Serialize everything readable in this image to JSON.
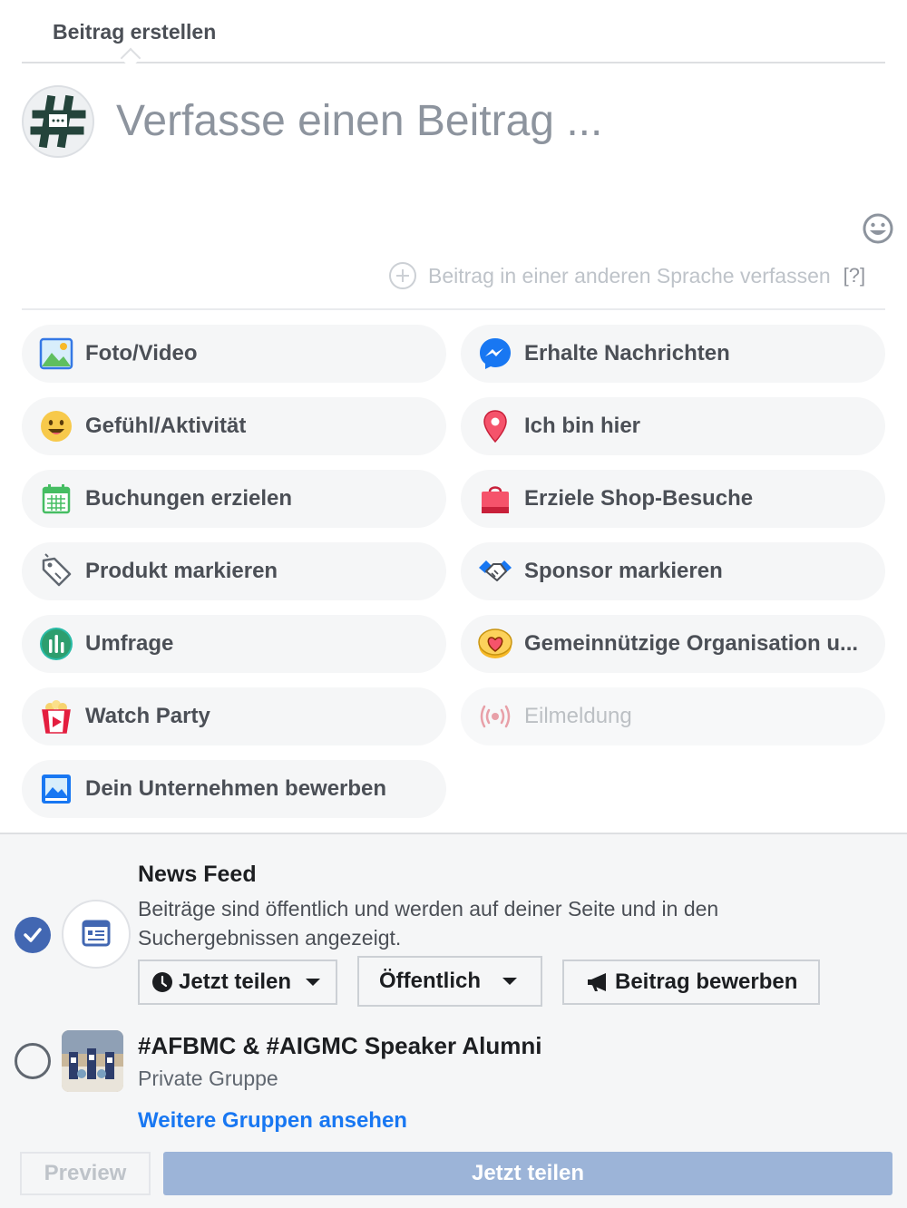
{
  "header": {
    "title": "Beitrag erstellen"
  },
  "composer": {
    "placeholder": "Verfasse einen Beitrag ..."
  },
  "language": {
    "text": "Beitrag in einer anderen Sprache verfassen",
    "help": "[?]"
  },
  "options": [
    {
      "label": "Foto/Video",
      "icon": "photo-icon"
    },
    {
      "label": "Erhalte Nachrichten",
      "icon": "messenger-icon"
    },
    {
      "label": "Gefühl/Aktivität",
      "icon": "smiley-icon"
    },
    {
      "label": "Ich bin hier",
      "icon": "location-pin-icon"
    },
    {
      "label": "Buchungen erzielen",
      "icon": "calendar-icon"
    },
    {
      "label": "Erziele Shop-Besuche",
      "icon": "shopping-bag-icon"
    },
    {
      "label": "Produkt markieren",
      "icon": "tag-icon"
    },
    {
      "label": "Sponsor markieren",
      "icon": "handshake-icon"
    },
    {
      "label": "Umfrage",
      "icon": "poll-icon"
    },
    {
      "label": "Gemeinnützige Organisation u...",
      "icon": "charity-heart-icon"
    },
    {
      "label": "Watch Party",
      "icon": "popcorn-icon"
    },
    {
      "label": "Eilmeldung",
      "icon": "broadcast-icon"
    },
    {
      "label": "Dein Unternehmen bewerben",
      "icon": "promote-image-icon"
    }
  ],
  "audience": {
    "news_feed": {
      "title": "News Feed",
      "description": "Beiträge sind öffentlich und werden auf deiner Seite und in den Suchergebnissen angezeigt.",
      "schedule_button": "Jetzt teilen",
      "privacy_button": "Öffentlich",
      "boost_button": "Beitrag bewerben"
    },
    "group": {
      "title": "#AFBMC & #AIGMC Speaker Alumni",
      "subtitle": "Private Gruppe"
    },
    "more_groups": "Weitere Gruppen ansehen"
  },
  "footer": {
    "preview": "Preview",
    "share": "Jetzt teilen"
  },
  "colors": {
    "primary": "#4267b2",
    "link": "#1877f2",
    "share_disabled": "#9cb4d8"
  }
}
